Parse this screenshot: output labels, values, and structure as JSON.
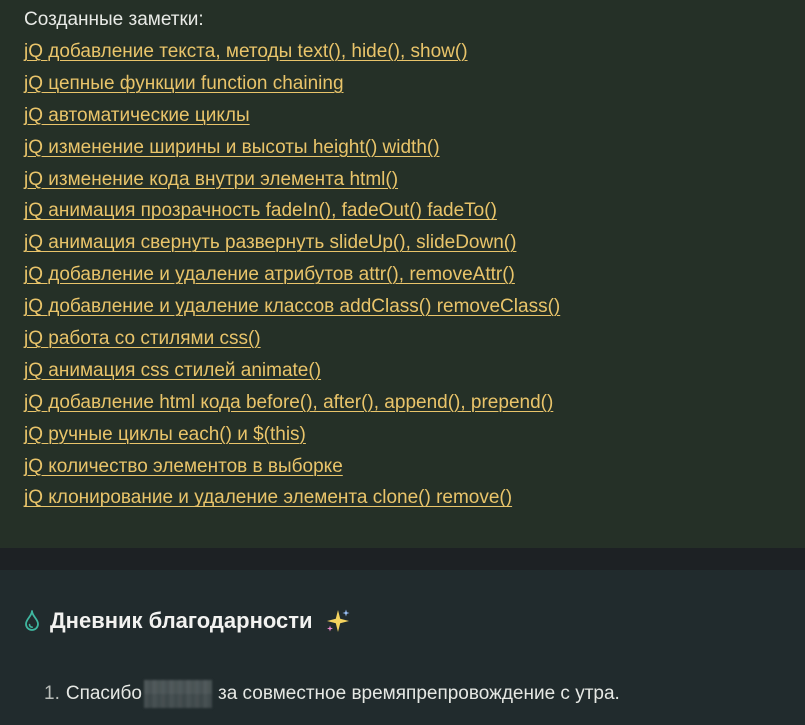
{
  "notes": {
    "heading": "Созданные заметки:",
    "items": [
      "jQ добавление текста, методы text(), hide(), show()",
      "jQ цепные функции function chaining",
      "jQ автоматические циклы",
      "jQ изменение ширины и высоты height() width()",
      "jQ изменение кода внутри элемента html()",
      "jQ анимация прозрачность fadeIn(), fadeOut() fadeTo()",
      "jQ анимация свернуть развернуть slideUp(), slideDown()",
      "jQ добавление и удаление атрибутов attr(), removeAttr()",
      "jQ добавление и удаление классов addClass() removeClass()",
      "jQ работа со стилями css()",
      "jQ анимация css стилей animate()",
      "jQ добавление html кода before(), after(), append(), prepend()",
      "jQ ручные циклы each() и $(this)",
      "jQ количество элементов в выборке",
      "jQ клонирование и удаление элемента clone() remove()"
    ]
  },
  "journal": {
    "title": "Дневник благодарности",
    "title_icon": "water-drop-icon",
    "trailing_icon": "sparkles-icon",
    "entries": [
      {
        "number": "1.",
        "before": "Спасибо",
        "after": "за совместное времяпрепровождение с утра."
      }
    ]
  },
  "colors": {
    "link": "#e9c46a",
    "notes_bg": "#253027",
    "journal_bg": "#212b2d",
    "accent_drop": "#3fb7a0"
  }
}
